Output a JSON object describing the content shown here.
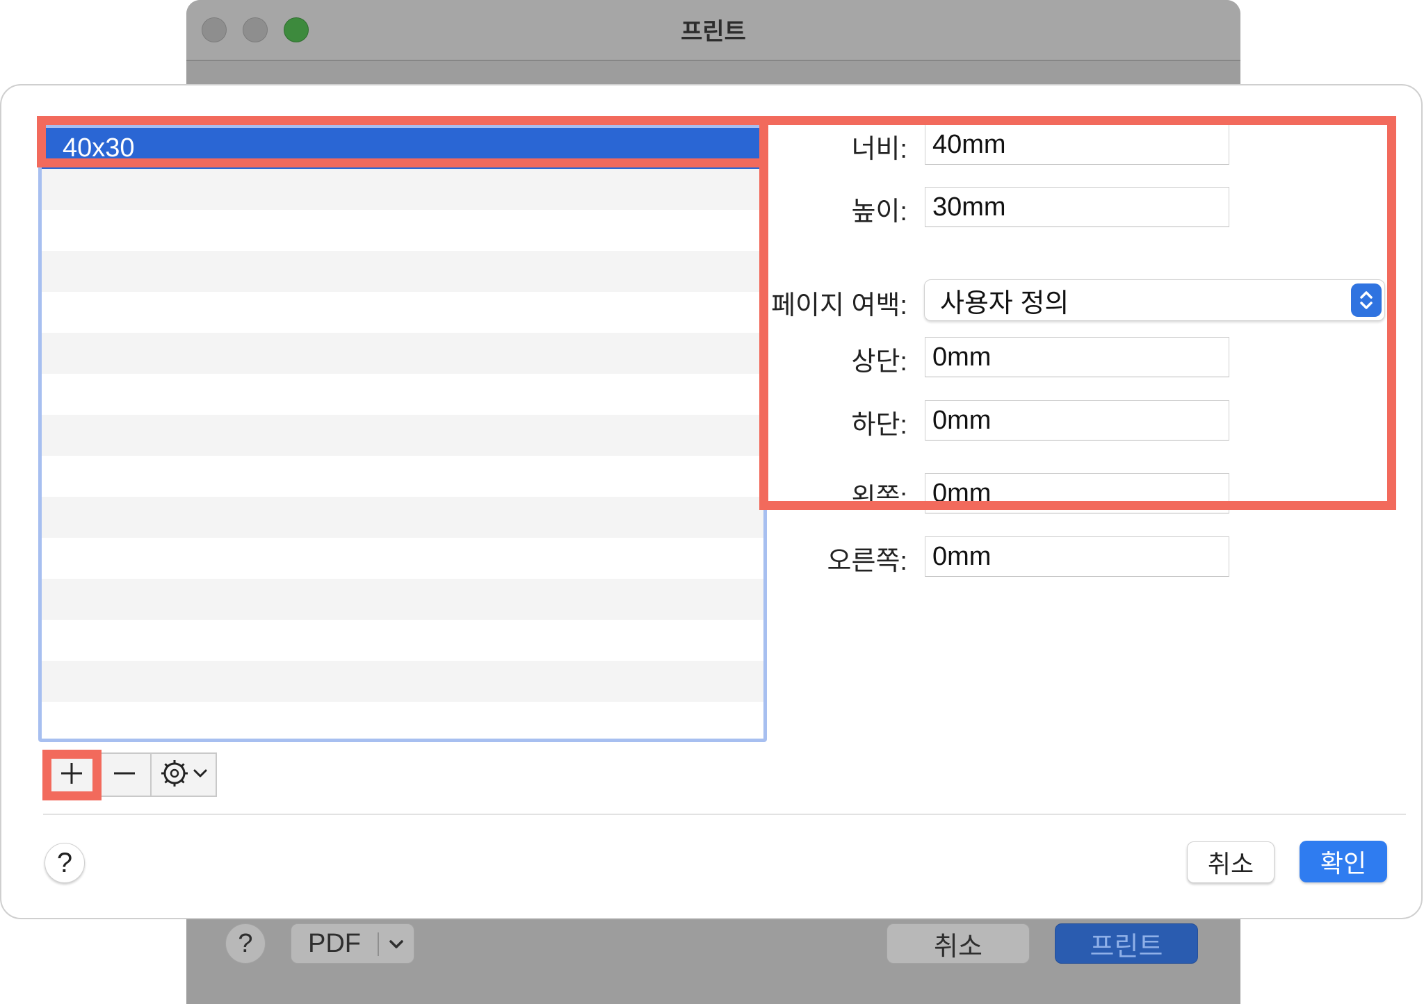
{
  "print_window": {
    "title": "프린트",
    "help_label": "?",
    "pdf_label": "PDF",
    "cancel_label": "취소",
    "print_label": "프린트"
  },
  "paper_list": {
    "selected_item": "40x30"
  },
  "size": {
    "width_label": "너비:",
    "width_value": "40mm",
    "height_label": "높이:",
    "height_value": "30mm"
  },
  "margins": {
    "page_margin_label": "페이지 여백:",
    "page_margin_value": "사용자 정의",
    "top_label": "상단:",
    "top_value": "0mm",
    "bottom_label": "하단:",
    "bottom_value": "0mm",
    "left_label": "왼쪽:",
    "left_value": "0mm",
    "right_label": "오른쪽:",
    "right_value": "0mm"
  },
  "footer": {
    "help_label": "?",
    "cancel_label": "취소",
    "ok_label": "확인"
  },
  "colors": {
    "highlight": "#f26a5c",
    "selection": "#2a66d4",
    "accent": "#2f7cf0"
  }
}
